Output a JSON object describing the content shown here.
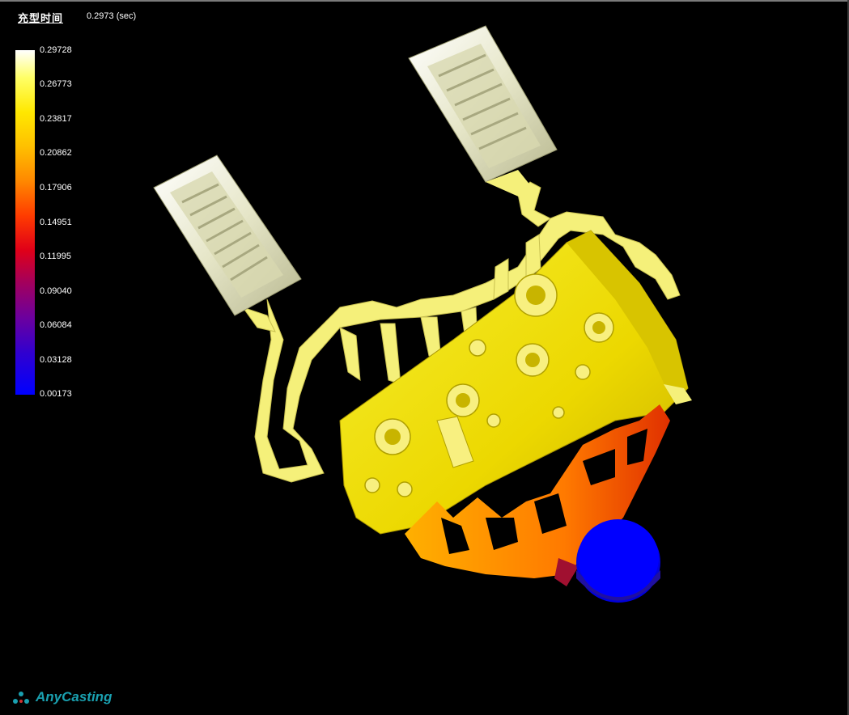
{
  "header": {
    "title": "充型时间",
    "time": "0.2973 (sec)"
  },
  "legend": {
    "ticks": [
      "0.29728",
      "0.26773",
      "0.23817",
      "0.20862",
      "0.17906",
      "0.14951",
      "0.11995",
      "0.09040",
      "0.06084",
      "0.03128",
      "0.00173"
    ]
  },
  "brand": {
    "name": "AnyCasting"
  },
  "colors": {
    "background": "#000000",
    "part": "#f0e000",
    "part_light": "#f5f07a",
    "riser": "#e8e8c8",
    "runner": "#ff8a00",
    "sprue": "#0000ff",
    "logo": "#1aa0b0"
  }
}
